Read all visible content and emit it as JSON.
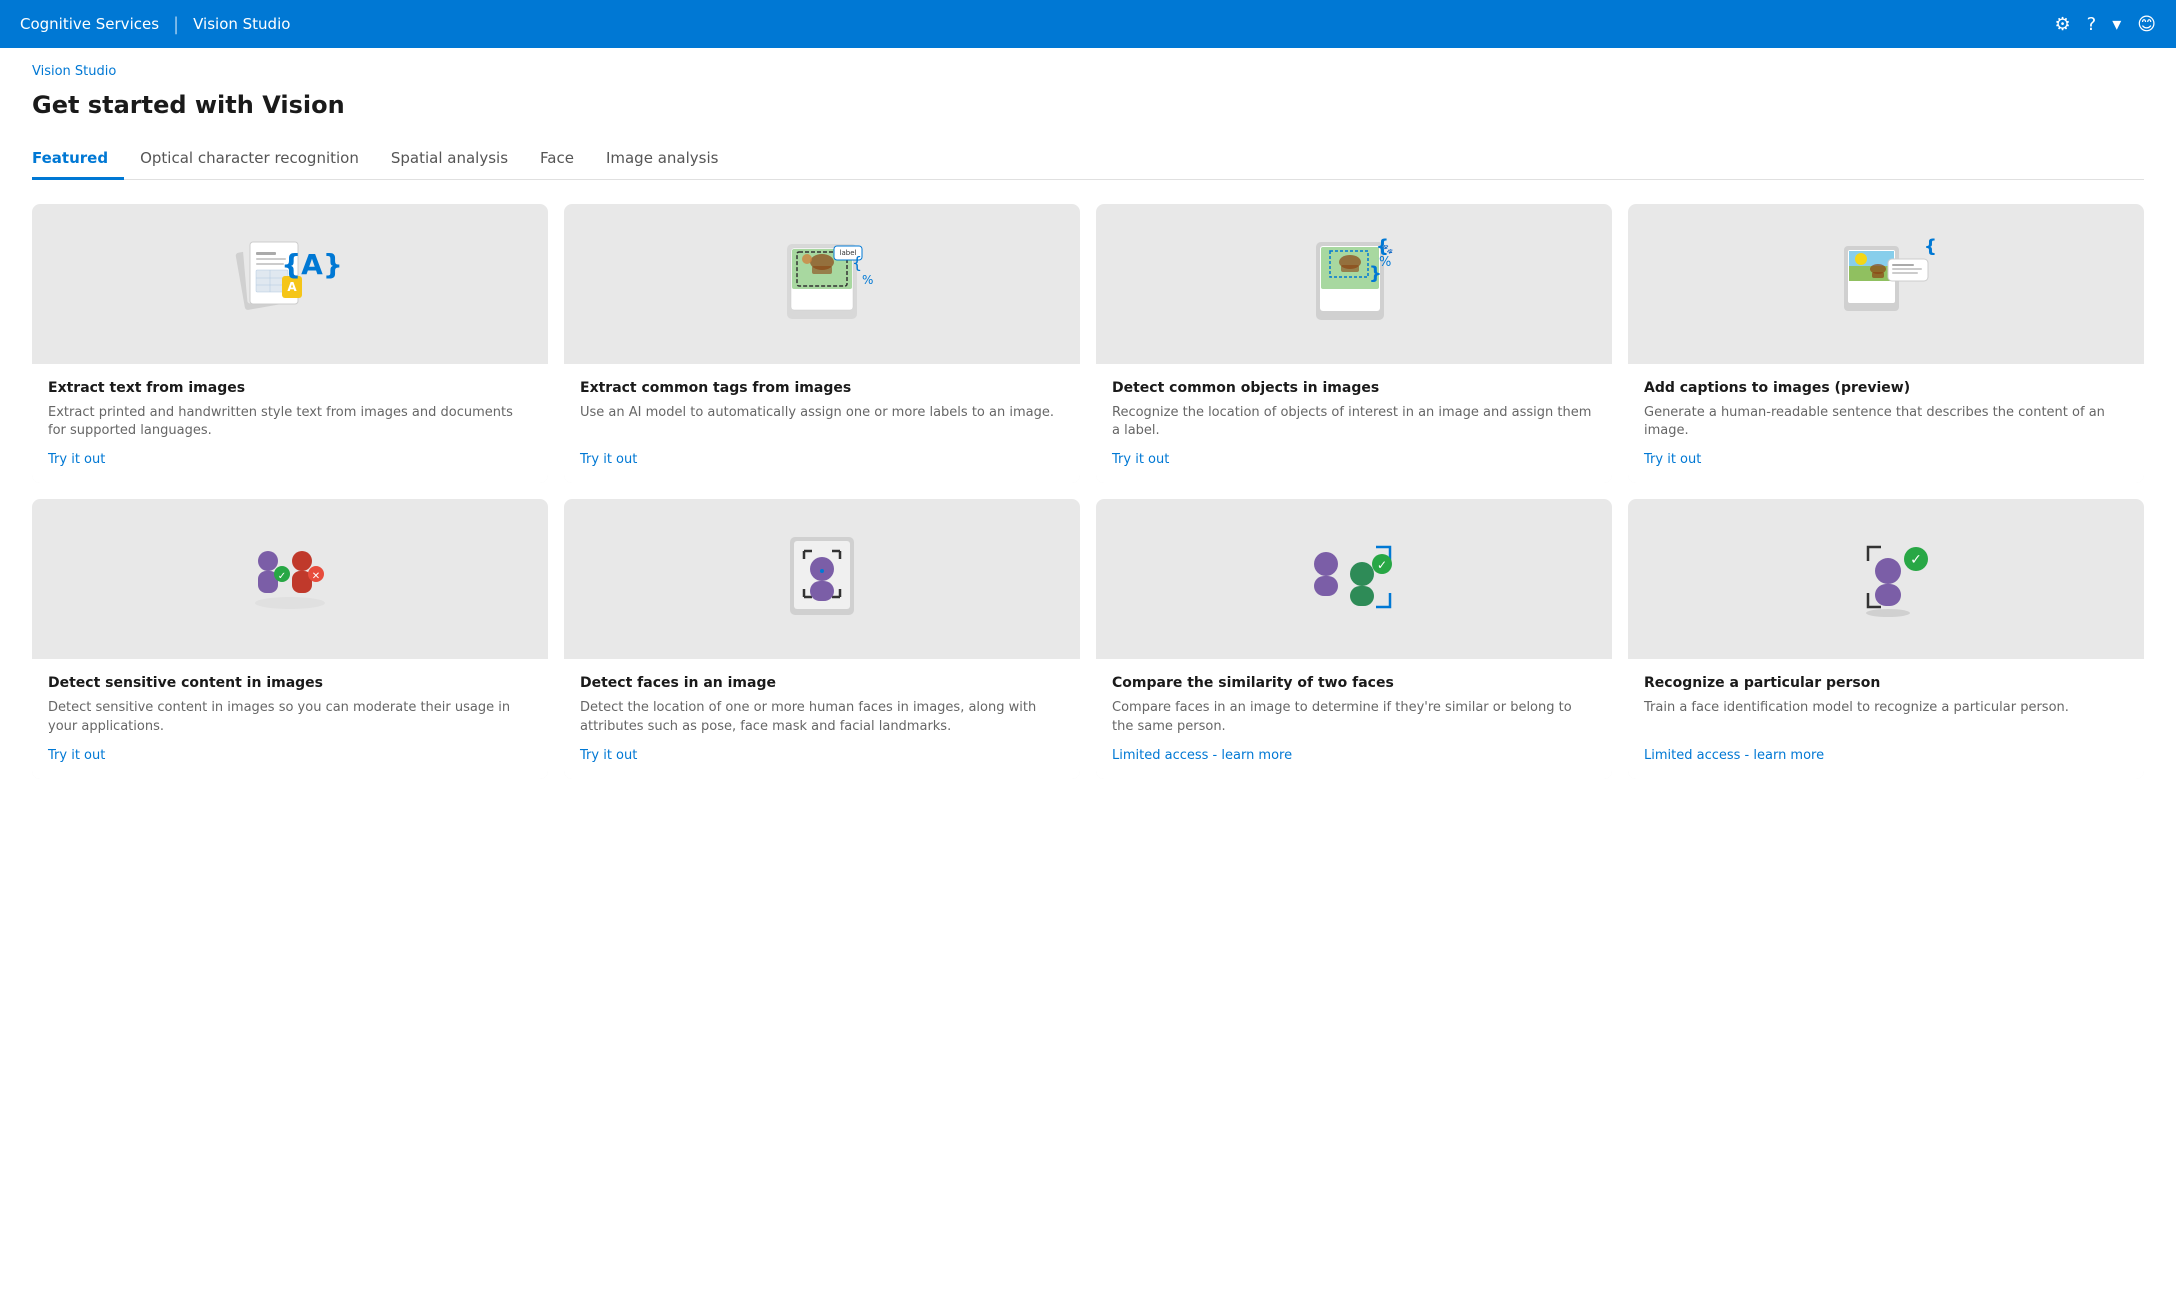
{
  "header": {
    "app_name": "Cognitive Services",
    "divider": "|",
    "product_name": "Vision Studio",
    "settings_icon": "⚙",
    "help_icon": "?",
    "chevron_icon": "▾",
    "user_icon": "😊"
  },
  "breadcrumb": "Vision Studio",
  "page_title": "Get started with Vision",
  "tabs": [
    {
      "id": "featured",
      "label": "Featured",
      "active": true
    },
    {
      "id": "ocr",
      "label": "Optical character recognition",
      "active": false
    },
    {
      "id": "spatial",
      "label": "Spatial analysis",
      "active": false
    },
    {
      "id": "face",
      "label": "Face",
      "active": false
    },
    {
      "id": "image",
      "label": "Image analysis",
      "active": false
    }
  ],
  "cards_row1": [
    {
      "id": "extract-text",
      "title": "Extract text from images",
      "description": "Extract printed and handwritten style text from images and documents for supported languages.",
      "link_label": "Try it out",
      "link_type": "try"
    },
    {
      "id": "extract-tags",
      "title": "Extract common tags from images",
      "description": "Use an AI model to automatically assign one or more labels to an image.",
      "link_label": "Try it out",
      "link_type": "try"
    },
    {
      "id": "detect-objects",
      "title": "Detect common objects in images",
      "description": "Recognize the location of objects of interest in an image and assign them a label.",
      "link_label": "Try it out",
      "link_type": "try"
    },
    {
      "id": "add-captions",
      "title": "Add captions to images (preview)",
      "description": "Generate a human-readable sentence that describes the content of an image.",
      "link_label": "Try it out",
      "link_type": "try"
    }
  ],
  "cards_row2": [
    {
      "id": "sensitive-content",
      "title": "Detect sensitive content in images",
      "description": "Detect sensitive content in images so you can moderate their usage in your applications.",
      "link_label": "Try it out",
      "link_type": "try"
    },
    {
      "id": "detect-faces",
      "title": "Detect faces in an image",
      "description": "Detect the location of one or more human faces in images, along with attributes such as pose, face mask and facial landmarks.",
      "link_label": "Try it out",
      "link_type": "try"
    },
    {
      "id": "compare-faces",
      "title": "Compare the similarity of two faces",
      "description": "Compare faces in an image to determine if they're similar or belong to the same person.",
      "link_label": "Limited access - learn more",
      "link_type": "limited"
    },
    {
      "id": "recognize-person",
      "title": "Recognize a particular person",
      "description": "Train a face identification model to recognize a particular person.",
      "link_label": "Limited access - learn more",
      "link_type": "limited"
    }
  ]
}
